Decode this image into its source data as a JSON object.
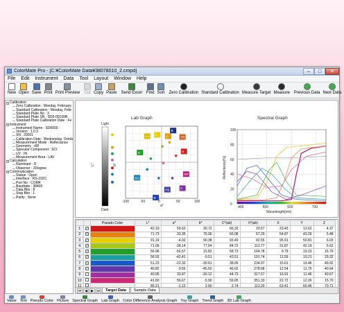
{
  "window": {
    "title": "ColorMate Pro - [C:¥ColorMate Data¥38078010_2.cmpd]",
    "min": "–",
    "max": "□",
    "close": "✕"
  },
  "menu": [
    "File",
    "Edit",
    "Instrument",
    "Data",
    "Tool",
    "Layout",
    "Window",
    "Help"
  ],
  "toolbar": [
    {
      "label": "New",
      "icon": "new-file-icon",
      "color": "#ffffff",
      "disabled": false
    },
    {
      "label": "Open",
      "icon": "open-folder-icon",
      "color": "#f0c040",
      "disabled": false
    },
    {
      "label": "Save",
      "icon": "save-disk-icon",
      "color": "#4a6fb5",
      "disabled": false
    },
    {
      "label": "Print",
      "icon": "print-icon",
      "color": "#808890",
      "disabled": false
    },
    {
      "label": "Print Preview",
      "icon": "print-preview-icon",
      "color": "#8090a0",
      "disabled": false
    },
    {
      "label": "Cut",
      "icon": "cut-icon",
      "color": "#b0b0b0",
      "disabled": true
    },
    {
      "label": "Copy",
      "icon": "copy-icon",
      "color": "#9ab0d0",
      "disabled": false
    },
    {
      "label": "Paste",
      "icon": "paste-icon",
      "color": "#c8a060",
      "disabled": false
    },
    {
      "label": "Send Excel",
      "icon": "excel-icon",
      "color": "#3a8a3a",
      "disabled": false
    },
    {
      "label": "Find",
      "icon": "find-icon",
      "color": "#607090",
      "disabled": false
    },
    {
      "label": "Sort",
      "icon": "sort-icon",
      "color": "#7090b0",
      "disabled": false
    },
    {
      "label": "Zero Calibration",
      "icon": "zero-calibration-icon",
      "color": "#202020",
      "disabled": false
    },
    {
      "label": "Standard Calibration",
      "icon": "standard-calibration-icon",
      "color": "#f4f4f4",
      "disabled": false
    },
    {
      "label": "Measure Target",
      "icon": "measure-target-icon",
      "color": "#3a3a3a",
      "disabled": false
    },
    {
      "label": "Measure",
      "icon": "measure-icon",
      "color": "#2a2a2a",
      "disabled": false
    },
    {
      "label": "Previous Data",
      "icon": "previous-data-icon",
      "color": "#3ab04a",
      "disabled": false
    },
    {
      "label": "Next Data",
      "icon": "next-data-icon",
      "color": "#3ab04a",
      "disabled": false
    }
  ],
  "tree": [
    {
      "label": "Calibration",
      "level": 0,
      "expander": "−"
    },
    {
      "label": "Zero Calibration : Monday, February",
      "level": 1
    },
    {
      "label": "Standard Calibration : Monday, Febr",
      "level": 1
    },
    {
      "label": "Standard Plate No : 3",
      "level": 1
    },
    {
      "label": "Standard Plate SN : SD6-00100R",
      "level": 1
    },
    {
      "label": "Standard Plate Calibration Date : Fe",
      "level": 1
    },
    {
      "label": "Instrument",
      "level": 0,
      "expander": "−"
    },
    {
      "label": "Instrument Name : SD6000",
      "level": 1
    },
    {
      "label": "Version : 1.0.3",
      "level": 1
    },
    {
      "label": "SN : 20001",
      "level": 1
    },
    {
      "label": "Calibration Date : Wednesday, Octob",
      "level": 1
    },
    {
      "label": "Measurement Mode : Reflectance",
      "level": 1
    },
    {
      "label": "Geometry : d/8",
      "level": 1
    },
    {
      "label": "Specular Component : SCI",
      "level": 1
    },
    {
      "label": "UV : IN",
      "level": 1
    },
    {
      "label": "Measurement Area : LAV",
      "level": 1
    },
    {
      "label": "Calculation",
      "level": 0,
      "expander": "−"
    },
    {
      "label": "Illuminant : D",
      "level": 1
    },
    {
      "label": "Observer : 2Degree",
      "level": 1
    },
    {
      "label": "Communication",
      "level": 0,
      "expander": "−"
    },
    {
      "label": "Status : Open",
      "level": 1
    },
    {
      "label": "Interface : RS-232C",
      "level": 1
    },
    {
      "label": "Port No : COM4",
      "level": 1
    },
    {
      "label": "Baudrate : 38400",
      "level": 1
    },
    {
      "label": "Data Bits : 8",
      "level": 1
    },
    {
      "label": "Stop Bits : 1",
      "level": 1
    },
    {
      "label": "Parity : None",
      "level": 1
    }
  ],
  "lab_graph": {
    "title": "Lab Graph",
    "lightness_label": "Light",
    "dark_label": "Dark",
    "l_axis_label": "L*",
    "b_axis_label": "b*",
    "a_axis_label": "a*",
    "ticks": [
      "-100",
      "-50",
      "0",
      "50",
      "100"
    ],
    "labels": [
      {
        "text": "YY",
        "color": "#d9c000",
        "a": -40,
        "b": 72
      },
      {
        "text": "Y",
        "color": "#e8d000",
        "a": -12,
        "b": 76
      },
      {
        "text": "O",
        "color": "#e89a00",
        "a": 18,
        "b": 72
      },
      {
        "text": "B",
        "color": "#203080",
        "a": 32,
        "b": 88
      },
      {
        "text": "YR",
        "color": "#d06020",
        "a": 58,
        "b": 70
      },
      {
        "text": "G",
        "color": "#20a020",
        "a": -60,
        "b": 27
      },
      {
        "text": "R",
        "color": "#d02020",
        "a": 62,
        "b": 30
      },
      {
        "text": "BG",
        "color": "#2080b0",
        "a": -68,
        "b": -43
      },
      {
        "text": "RP",
        "color": "#c02080",
        "a": 68,
        "b": -33
      },
      {
        "text": "PB",
        "color": "#4040a0",
        "a": 16,
        "b": -76
      },
      {
        "text": "P",
        "color": "#8030a0",
        "a": 58,
        "b": -72
      },
      {
        "text": "B",
        "color": "#2040c0",
        "a": -16,
        "b": -98
      }
    ],
    "points": [
      {
        "a": -30,
        "b": 10,
        "color": "#20a060"
      },
      {
        "a": 2,
        "b": 44,
        "color": "#a0a040"
      },
      {
        "a": 5,
        "b": -2,
        "color": "#e06090"
      },
      {
        "a": -40,
        "b": -20,
        "color": "#2080a0"
      },
      {
        "a": -8,
        "b": -44,
        "color": "#3060c0"
      },
      {
        "a": 30,
        "b": -44,
        "color": "#6040a0"
      },
      {
        "a": 40,
        "b": 18,
        "color": "#e03030"
      },
      {
        "a": 22,
        "b": 55,
        "color": "#e0a000"
      }
    ],
    "lightness_points": [
      {
        "l": 90,
        "color": "#e8d000"
      },
      {
        "l": 74,
        "color": "#e0a000"
      },
      {
        "l": 66,
        "color": "#20a060"
      },
      {
        "l": 58,
        "color": "#e06090"
      },
      {
        "l": 48,
        "color": "#d02020"
      },
      {
        "l": 40,
        "color": "#2080a0"
      },
      {
        "l": 30,
        "color": "#3060c0"
      }
    ]
  },
  "spectral_graph": {
    "title": "Spectral Graph",
    "ylabel": "Reflectance[%]",
    "xlabel": "Wavelength[nm]",
    "x_ticks": [
      "400",
      "500",
      "600",
      "700"
    ],
    "y_ticks": [
      "0",
      "20",
      "40",
      "60",
      "80",
      "100"
    ],
    "xlim": [
      380,
      740
    ],
    "ylim": [
      0,
      100
    ],
    "series": [
      {
        "color": "#c01060",
        "points": [
          [
            380,
            4
          ],
          [
            450,
            4
          ],
          [
            560,
            4
          ],
          [
            600,
            6
          ],
          [
            620,
            40
          ],
          [
            640,
            68
          ],
          [
            680,
            75
          ],
          [
            740,
            78
          ]
        ]
      },
      {
        "color": "#e88040",
        "points": [
          [
            380,
            5
          ],
          [
            480,
            5
          ],
          [
            540,
            8
          ],
          [
            570,
            30
          ],
          [
            600,
            62
          ],
          [
            640,
            74
          ],
          [
            740,
            78
          ]
        ]
      },
      {
        "color": "#e8c000",
        "points": [
          [
            380,
            6
          ],
          [
            460,
            8
          ],
          [
            500,
            28
          ],
          [
            540,
            64
          ],
          [
            580,
            76
          ],
          [
            740,
            82
          ]
        ]
      },
      {
        "color": "#3ab04a",
        "points": [
          [
            380,
            6
          ],
          [
            460,
            12
          ],
          [
            510,
            46
          ],
          [
            540,
            56
          ],
          [
            580,
            30
          ],
          [
            620,
            12
          ],
          [
            740,
            10
          ]
        ]
      },
      {
        "color": "#2aa0c0",
        "points": [
          [
            380,
            10
          ],
          [
            440,
            34
          ],
          [
            480,
            48
          ],
          [
            520,
            40
          ],
          [
            580,
            18
          ],
          [
            620,
            8
          ],
          [
            740,
            6
          ]
        ]
      },
      {
        "color": "#3060d0",
        "points": [
          [
            380,
            24
          ],
          [
            420,
            48
          ],
          [
            460,
            52
          ],
          [
            500,
            36
          ],
          [
            560,
            12
          ],
          [
            620,
            6
          ],
          [
            740,
            4
          ]
        ]
      },
      {
        "color": "#8040b0",
        "points": [
          [
            380,
            30
          ],
          [
            420,
            44
          ],
          [
            460,
            40
          ],
          [
            520,
            16
          ],
          [
            580,
            6
          ],
          [
            640,
            12
          ],
          [
            740,
            24
          ]
        ]
      },
      {
        "color": "#e06090",
        "points": [
          [
            380,
            40
          ],
          [
            440,
            34
          ],
          [
            500,
            22
          ],
          [
            560,
            24
          ],
          [
            600,
            46
          ],
          [
            660,
            64
          ],
          [
            740,
            70
          ]
        ]
      },
      {
        "color": "#a0a0a0",
        "points": [
          [
            380,
            60
          ],
          [
            500,
            62
          ],
          [
            600,
            62
          ],
          [
            740,
            64
          ]
        ]
      }
    ]
  },
  "table": {
    "headers": [
      "",
      "",
      "Pseudo Color",
      "L*",
      "a*",
      "b*",
      "C*(ab)",
      "h*(ab)",
      "X",
      "Y",
      "Z"
    ],
    "rows": [
      {
        "n": "1",
        "checked": true,
        "color": "#d01818",
        "L": "42.19",
        "a": "59.62",
        "b": "30.72",
        "C": "66.32",
        "h": "29.57",
        "X": "23.43",
        "Y": "12.62",
        "Z": "4.37"
      },
      {
        "n": "2",
        "checked": true,
        "color": "#e88010",
        "L": "71.73",
        "a": "33.35",
        "b": "76.06",
        "C": "66.08",
        "h": "67.29",
        "X": "54.87",
        "Y": "43.26",
        "Z": "5.48"
      },
      {
        "n": "3",
        "checked": true,
        "color": "#e8d000",
        "L": "91.19",
        "a": "-4.02",
        "b": "90.38",
        "C": "93.40",
        "h": "92.55",
        "X": "95.91",
        "Y": "50.81",
        "Z": "6.03"
      },
      {
        "n": "4",
        "checked": true,
        "color": "#a8c818",
        "L": "71.09",
        "a": "-38.14",
        "b": "77.54",
        "C": "84.72",
        "h": "113.77",
        "X": "31.87",
        "Y": "42.19",
        "Z": "5.62"
      },
      {
        "n": "5",
        "checked": true,
        "color": "#20a028",
        "L": "56.96",
        "a": "-56.57",
        "b": "15.82",
        "C": "58.73",
        "h": "164.78",
        "X": "9.79",
        "Y": "19.23",
        "Z": "16.79"
      },
      {
        "n": "6",
        "checked": true,
        "color": "#18a0a0",
        "L": "58.93",
        "a": "-42.41",
        "b": "-9.51",
        "C": "43.51",
        "h": "191.74",
        "X": "11.59",
        "Y": "19.21",
        "Z": "29.32"
      },
      {
        "n": "7",
        "checked": true,
        "color": "#1858c8",
        "L": "51.23",
        "a": "-22.33",
        "b": "-30.61",
        "C": "38.05",
        "h": "234.97",
        "X": "15.61",
        "Y": "19.46",
        "Z": "49.92"
      },
      {
        "n": "8",
        "checked": true,
        "color": "#6038a8",
        "L": "40.82",
        "a": "9.55",
        "b": "-45.50",
        "C": "46.62",
        "h": "278.68",
        "X": "12.54",
        "Y": "11.75",
        "Z": "40.64"
      },
      {
        "n": "9",
        "checked": false,
        "color": "#a030a0",
        "L": "40.05",
        "a": "33.97",
        "b": "-30.12",
        "C": "44.73",
        "h": "317.57",
        "X": "16.91",
        "Y": "11.46",
        "Z": "40.67"
      },
      {
        "n": "10",
        "checked": false,
        "color": "#d02878",
        "L": "41.60",
        "a": "56.67",
        "b": "-5.90",
        "C": "59.05",
        "h": "351.33",
        "X": "22.72",
        "Y": "12.26",
        "Z": "15.70"
      },
      {
        "n": "11",
        "checked": false,
        "color": "#f0f0f0",
        "L": "85.21",
        "a": "-1.12",
        "b": "2.50",
        "C": "2.74",
        "h": "113.20",
        "X": "63.41",
        "Y": "66.46",
        "Z": "70.71"
      }
    ]
  },
  "sheet_tabs": {
    "nav": [
      "⏮",
      "◀",
      "▶",
      "⏭"
    ],
    "tabs": [
      "Target Data",
      "Sample Data"
    ]
  },
  "bottom_buttons": [
    {
      "label": "Value",
      "color": "#6a8ad0"
    },
    {
      "label": "Text",
      "color": "#7090c0"
    },
    {
      "label": "Pseudo Color",
      "color": "#d04040"
    },
    {
      "label": "Picture",
      "color": "#8080a0"
    },
    {
      "label": "Spectral Graph",
      "color": "#3a8040"
    },
    {
      "label": "Lab Graph",
      "color": "#4060b0"
    },
    {
      "label": "Color Difference Analysis Graph",
      "color": "#606060"
    },
    {
      "label": "Yxy Graph",
      "color": "#40a0a0"
    },
    {
      "label": "Trend Graph",
      "color": "#3060a0"
    },
    {
      "label": "3D Lab Graph",
      "color": "#50a060"
    }
  ]
}
